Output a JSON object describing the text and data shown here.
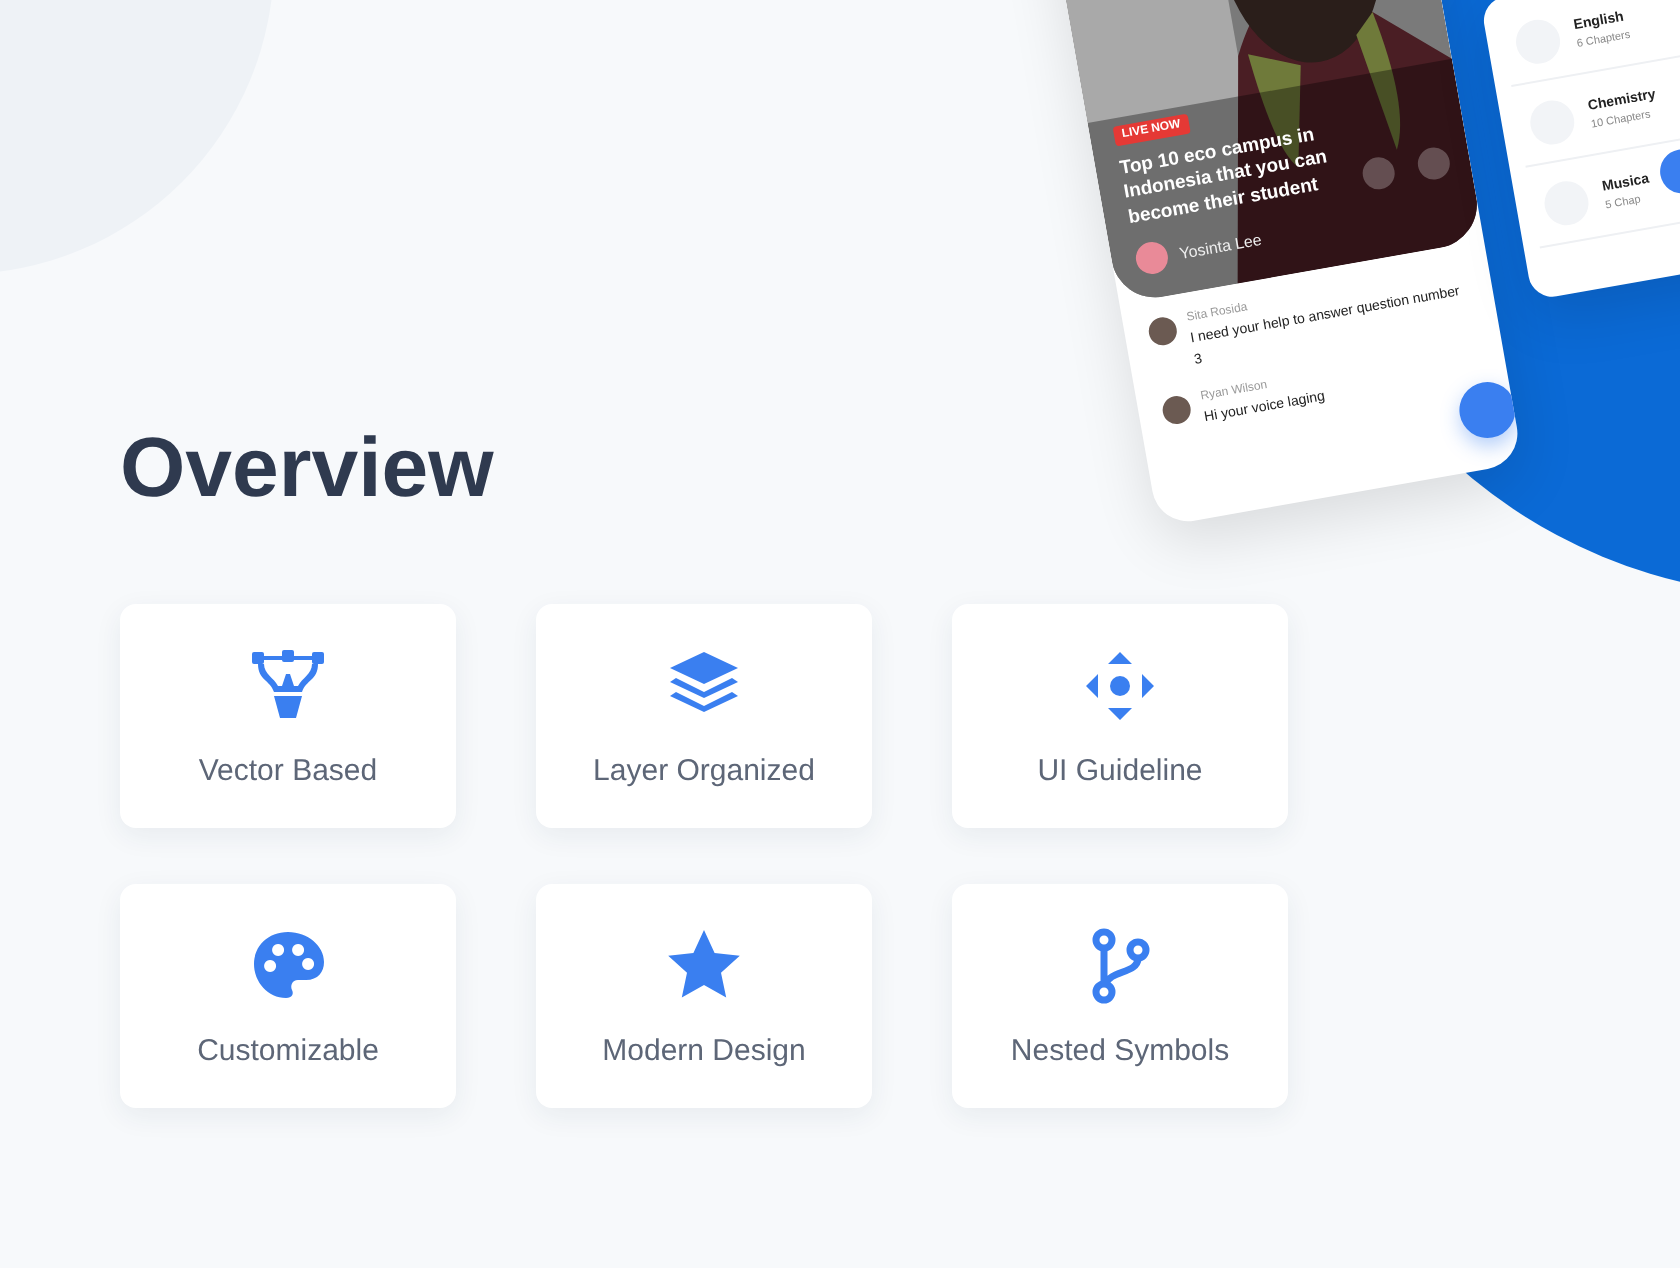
{
  "title": "Overview",
  "features": [
    {
      "kind": "pen",
      "label": "Vector Based"
    },
    {
      "kind": "layers",
      "label": "Layer Organized"
    },
    {
      "kind": "move",
      "label": "UI Guideline"
    },
    {
      "kind": "palette",
      "label": "Customizable"
    },
    {
      "kind": "star",
      "label": "Modern Design"
    },
    {
      "kind": "branch",
      "label": "Nested Symbols"
    }
  ],
  "live_card": {
    "badge": "LIVE NOW",
    "headline": "Top 10 eco campus in Indonesia that you can become their student",
    "host": "Yosinta Lee"
  },
  "comments": [
    {
      "author": "Sita Rosida",
      "text": "I need your help to answer question number 3"
    },
    {
      "author": "Ryan Wilson",
      "text": "Hi your voice laging"
    }
  ],
  "courses": [
    {
      "name": "English",
      "chapters": "6 Chapters"
    },
    {
      "name": "Chemistry",
      "chapters": "10 Chapters"
    },
    {
      "name": "Musica",
      "chapters": "5 Chap"
    }
  ]
}
